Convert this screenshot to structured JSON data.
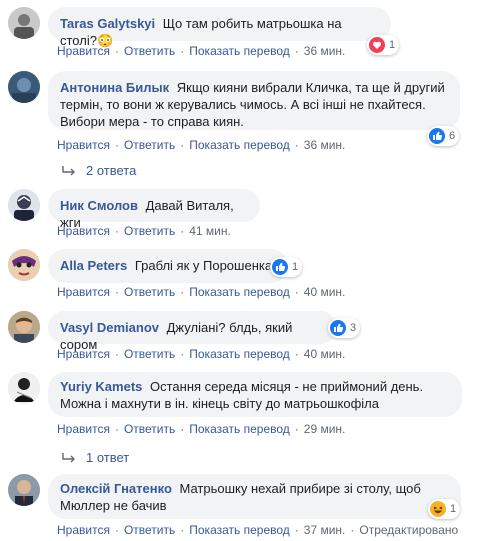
{
  "actions": {
    "like": "Нравится",
    "reply": "Ответить",
    "translate": "Показать перевод",
    "dot": "·"
  },
  "comments": [
    {
      "author": "Taras Galytskyi",
      "text": "Що там робить матрьошка на столі?",
      "emoji": "😳",
      "time": "36 мин.",
      "reaction_count": "1",
      "reaction_type": "heart-icon"
    },
    {
      "author": "Антонина Билык",
      "text": "Якщо кияни вибрали Кличка, та ще й другий термін, то вони ж керувались чимось. А всі інші не пхайтеся. Вибори мера - то справа киян.",
      "time": "36 мин.",
      "reaction_count": "6",
      "reaction_type": "like-icon",
      "replies": "2 ответа"
    },
    {
      "author": "Ник Смолов",
      "text": "Давай Виталя, жги",
      "time": "41 мин."
    },
    {
      "author": "Alla Peters",
      "text": "Граблі як у Порошенка!",
      "time": "40 мин.",
      "reaction_count": "1",
      "reaction_type": "like-icon"
    },
    {
      "author": "Vasyl Demianov",
      "text": "Джуліані? блдь, який сором",
      "time": "40 мин.",
      "reaction_count": "3",
      "reaction_type": "like-icon"
    },
    {
      "author": "Yuriy Kamets",
      "text": "Остання середа місяця - не приймоний день. Можна і махнути в ін. кінець світу до матрьошкофіла",
      "time": "29 мин.",
      "replies": "1 ответ"
    },
    {
      "author": "Олексій Гнатенко",
      "text": "Матрьошку нехай прибире зі столу, щоб Мюллер не бачив",
      "time": "37 мин.",
      "edited": "Отредактировано",
      "reaction_count": "1",
      "reaction_type": "haha-icon"
    }
  ],
  "colors": {
    "link": "#385898",
    "bubble": "#f2f3f5",
    "meta": "#606770",
    "like_blue": "#1877f2",
    "love_red": "#f33e58",
    "haha_yellow": "#f7b125"
  }
}
